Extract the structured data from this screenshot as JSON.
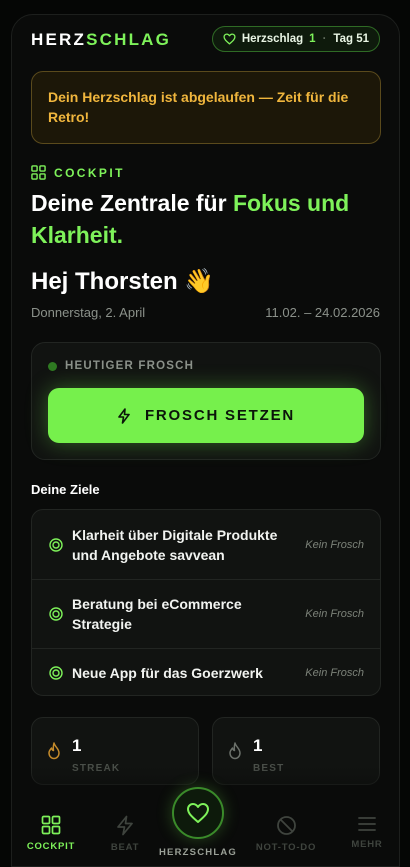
{
  "header": {
    "logo_part1": "HERZ",
    "logo_part2": "SCHLAG",
    "pill_label": "Herzschlag",
    "pill_count": "1",
    "pill_day": "Tag 51"
  },
  "alert": {
    "text": "Dein Herzschlag ist abgelaufen — Zeit für die Retro!"
  },
  "section": {
    "eyebrow": "COCKPIT",
    "headline_part1": "Deine Zentrale für ",
    "headline_part2": "Fokus und Klarheit."
  },
  "greeting": {
    "text": "Hej Thorsten 👋",
    "date": "Donnerstag, 2. April",
    "range": "11.02. – 24.02.2026"
  },
  "frog": {
    "label": "HEUTIGER FROSCH",
    "button": "FROSCH SETZEN"
  },
  "goals": {
    "title": "Deine Ziele",
    "items": [
      {
        "text": "Klarheit über Digitale Produkte und Angebote savvean",
        "status": "Kein Frosch"
      },
      {
        "text": "Beratung bei eCommerce Strategie",
        "status": "Kein Frosch"
      },
      {
        "text": "Neue App für das Goerzwerk",
        "status": "Kein Frosch"
      }
    ]
  },
  "stats": [
    {
      "value": "1",
      "label": "STREAK",
      "icon": "flame-icon"
    },
    {
      "value": "1",
      "label": "BEST",
      "icon": "flame-outline-icon"
    }
  ],
  "nav": {
    "items": [
      {
        "label": "COCKPIT",
        "icon": "grid-icon"
      },
      {
        "label": "BEAT",
        "icon": "bolt-icon"
      },
      {
        "label": "HERZSCHLAG",
        "icon": "heart-icon"
      },
      {
        "label": "NOT-TO-DO",
        "icon": "forbidden-icon"
      },
      {
        "label": "MEHR",
        "icon": "menu-icon"
      }
    ]
  },
  "colors": {
    "accent": "#7ef25a",
    "warning": "#f0b63d",
    "background": "#0a0b0a"
  }
}
